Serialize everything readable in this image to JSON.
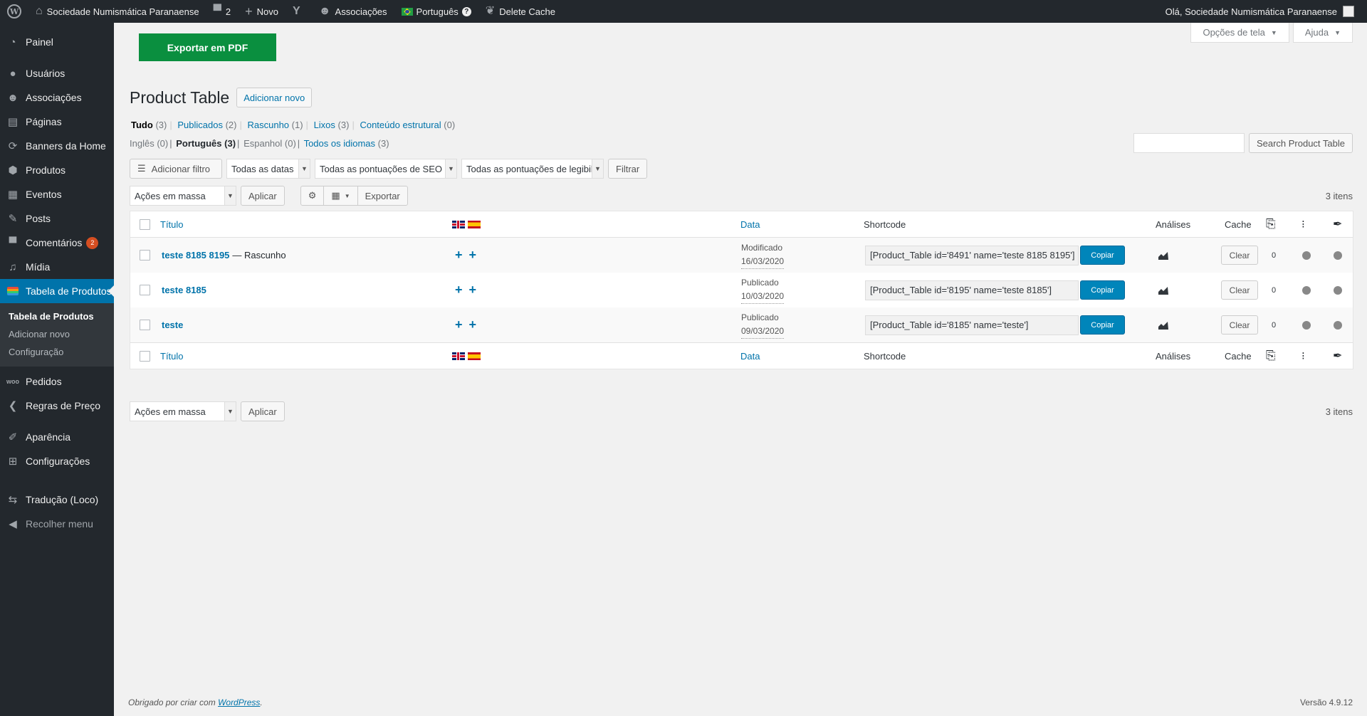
{
  "adminbar": {
    "site_name": "Sociedade Numismática Paranaense",
    "comments_count": "2",
    "new_label": "Novo",
    "associations_label": "Associações",
    "language_label": "Português",
    "delete_cache_label": "Delete Cache",
    "greeting": "Olá, Sociedade Numismática Paranaense"
  },
  "sidebar": {
    "items": [
      {
        "label": "Painel",
        "icon": "dashboard-icon"
      },
      {
        "label": "Usuários",
        "icon": "users-icon"
      },
      {
        "label": "Associações",
        "icon": "groups-icon"
      },
      {
        "label": "Páginas",
        "icon": "pages-icon"
      },
      {
        "label": "Banners da Home",
        "icon": "refresh-icon"
      },
      {
        "label": "Produtos",
        "icon": "products-icon"
      },
      {
        "label": "Eventos",
        "icon": "calendar-icon"
      },
      {
        "label": "Posts",
        "icon": "pin-icon"
      },
      {
        "label": "Comentários",
        "icon": "comments-icon",
        "badge": "2"
      },
      {
        "label": "Mídia",
        "icon": "media-icon"
      },
      {
        "label": "Tabela de Produtos",
        "icon": "table-icon"
      }
    ],
    "submenu": [
      "Tabela de Produtos",
      "Adicionar novo",
      "Configuração"
    ],
    "items2": [
      {
        "label": "Pedidos",
        "icon": "woo-icon"
      },
      {
        "label": "Regras de Preço",
        "icon": "chevron-left-icon"
      },
      {
        "label": "Aparência",
        "icon": "brush-icon"
      },
      {
        "label": "Configurações",
        "icon": "settings-icon"
      },
      {
        "label": "Tradução (Loco)",
        "icon": "translate-icon"
      },
      {
        "label": "Recolher menu",
        "icon": "collapse-icon"
      }
    ]
  },
  "screen_options": {
    "options_label": "Opções de tela",
    "help_label": "Ajuda"
  },
  "export_pdf_label": "Exportar em PDF",
  "page": {
    "title": "Product Table",
    "add_new_label": "Adicionar novo"
  },
  "views": [
    {
      "label": "Tudo",
      "count": "(3)"
    },
    {
      "label": "Publicados",
      "count": "(2)"
    },
    {
      "label": "Rascunho",
      "count": "(1)"
    },
    {
      "label": "Lixos",
      "count": "(3)"
    },
    {
      "label": "Conteúdo estrutural",
      "count": "(0)"
    }
  ],
  "languages": [
    {
      "label": "Inglês",
      "count": "(0)"
    },
    {
      "label": "Português",
      "count": "(3)"
    },
    {
      "label": "Espanhol",
      "count": "(0)"
    },
    {
      "label": "Todos os idiomas",
      "count": "(3)"
    }
  ],
  "search": {
    "button_label": "Search Product Table"
  },
  "filters": {
    "add_filter_label": "Adicionar filtro",
    "dates_selected": "Todas as datas",
    "seo_selected": "Todas as pontuações de SEO",
    "readability_selected": "Todas as pontuações de legibilidade",
    "filter_button": "Filtrar"
  },
  "bulk": {
    "selected": "Ações em massa",
    "apply_label": "Aplicar",
    "export_label": "Exportar"
  },
  "items_count": "3 itens",
  "table": {
    "headers": {
      "title": "Título",
      "date": "Data",
      "shortcode": "Shortcode",
      "analytics": "Análises",
      "cache": "Cache"
    },
    "rows": [
      {
        "title": "teste 8185 8195",
        "state": "— Rascunho",
        "status": "Modificado",
        "date": "16/03/2020",
        "shortcode": "[Product_Table id='8491' name='teste 8185 8195']",
        "copy": "Copiar",
        "clear": "Clear",
        "count": "0"
      },
      {
        "title": "teste 8185",
        "state": "",
        "status": "Publicado",
        "date": "10/03/2020",
        "shortcode": "[Product_Table id='8195' name='teste 8185']",
        "copy": "Copiar",
        "clear": "Clear",
        "count": "0"
      },
      {
        "title": "teste",
        "state": "",
        "status": "Publicado",
        "date": "09/03/2020",
        "shortcode": "[Product_Table id='8185' name='teste']",
        "copy": "Copiar",
        "clear": "Clear",
        "count": "0"
      }
    ]
  },
  "footer": {
    "thanks_prefix": "Obrigado por criar com",
    "wordpress": "WordPress",
    "suffix": ".",
    "version": "Versão 4.9.12"
  }
}
